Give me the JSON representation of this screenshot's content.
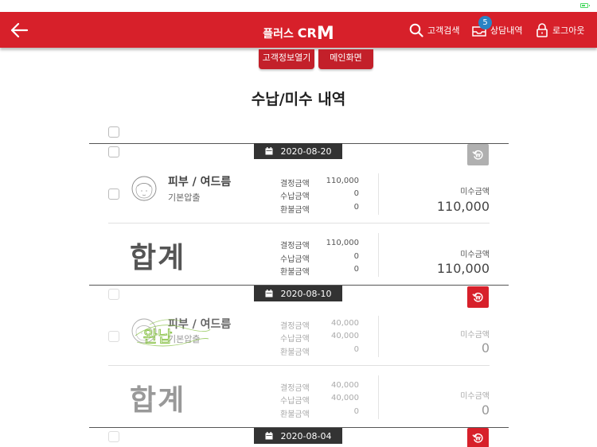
{
  "header": {
    "logo_prefix": "플러스 ",
    "logo_c": "CR",
    "logo_m": "M",
    "search_label": "고객검색",
    "consult_label": "상담내역",
    "consult_badge": "5",
    "logout_label": "로그아웃"
  },
  "nav_buttons": {
    "customer_info": "고객정보열기",
    "main_screen": "메인화면"
  },
  "page_title": "수납/미수 내역",
  "labels": {
    "decided": "결정금액",
    "paid": "수납금액",
    "refund": "환불금액",
    "outstanding": "미수금액",
    "total": "합계"
  },
  "records": [
    {
      "date": "2020-08-20",
      "product": "피부 / 여드름",
      "type": "기본압출",
      "decided": "110,000",
      "paid": "0",
      "refund": "0",
      "outstanding": "110,000",
      "total_decided": "110,000",
      "total_paid": "0",
      "total_refund": "0",
      "total_outstanding": "110,000",
      "state_color": "#b0b0b0"
    },
    {
      "date": "2020-08-10",
      "product": "피부 / 여드름",
      "type": "기본압출",
      "decided": "40,000",
      "paid": "40,000",
      "refund": "0",
      "outstanding": "0",
      "total_decided": "40,000",
      "total_paid": "40,000",
      "total_refund": "0",
      "total_outstanding": "0",
      "stamp_text": "완납",
      "state_color": "#d7202a"
    },
    {
      "date": "2020-08-04",
      "state_color": "#d7202a"
    }
  ],
  "colors": {
    "brand": "#d7202a",
    "badge": "#2a83c4",
    "stamp": "#8bc34a"
  }
}
